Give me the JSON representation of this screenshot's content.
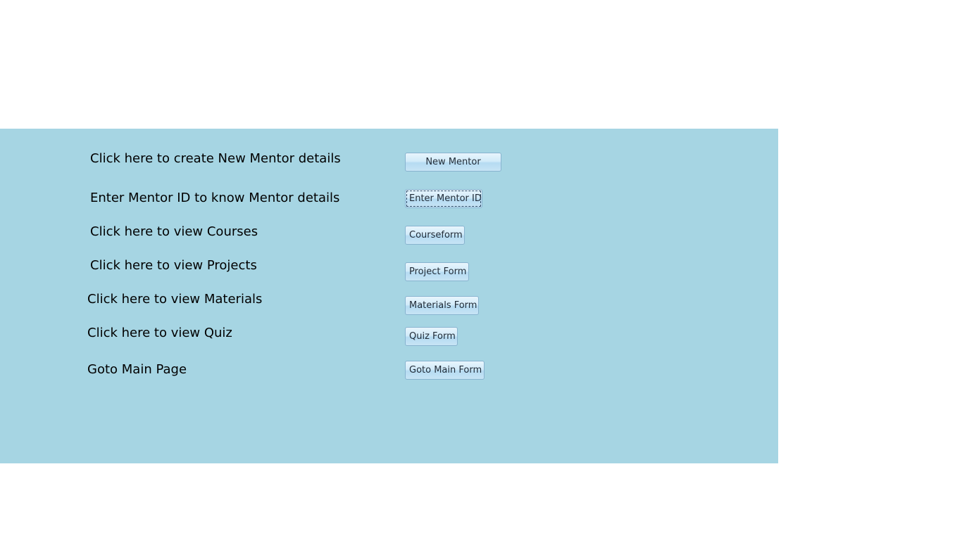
{
  "form": {
    "rows": [
      {
        "label": "Click here to create New Mentor details",
        "button": "New Mentor"
      },
      {
        "label": "Enter Mentor ID to know Mentor details",
        "button": "Enter Mentor ID"
      },
      {
        "label": "Click here to view Courses",
        "button": "Courseform"
      },
      {
        "label": "Click here to view Projects",
        "button": "Project Form"
      },
      {
        "label": "Click here to view Materials",
        "button": "Materials Form"
      },
      {
        "label": "Click here to view Quiz",
        "button": "Quiz Form"
      },
      {
        "label": "Goto Main Page",
        "button": "Goto Main Form"
      }
    ]
  },
  "colors": {
    "panel_background": "#a6d5e3",
    "page_background": "#ffffff",
    "button_border": "#88b3cf"
  }
}
